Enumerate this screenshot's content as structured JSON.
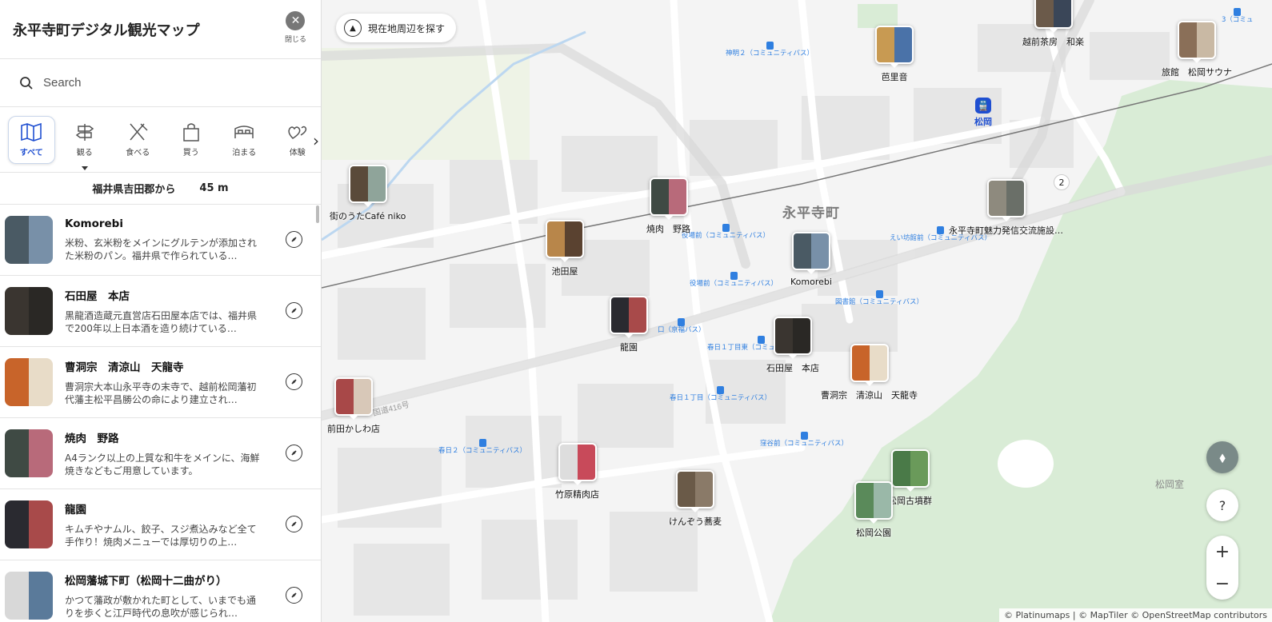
{
  "sidebar": {
    "title": "永平寺町デジタル観光マップ",
    "close_label": "閉じる",
    "search_placeholder": "Search",
    "categories": [
      {
        "label": "すべて",
        "icon": "map-icon"
      },
      {
        "label": "観る",
        "icon": "signpost-icon"
      },
      {
        "label": "食べる",
        "icon": "fork-knife-icon"
      },
      {
        "label": "買う",
        "icon": "shopping-bag-icon"
      },
      {
        "label": "泊まる",
        "icon": "bed-icon"
      },
      {
        "label": "体験",
        "icon": "hearts-icon"
      }
    ],
    "distance_from": "福井県吉田郡から",
    "distance_value": "45 m",
    "items": [
      {
        "name": "Komorebi",
        "desc": "米粉、玄米粉をメインにグルテンが添加された米粉のパン。福井県で作られている…"
      },
      {
        "name": "石田屋　本店",
        "desc": "黒龍酒造蔵元直営店石田屋本店では、福井県で200年以上日本酒を造り続けている…"
      },
      {
        "name": "曹洞宗　清涼山　天龍寺",
        "desc": "曹洞宗大本山永平寺の末寺で、越前松岡藩初代藩主松平昌勝公の命により建立され…"
      },
      {
        "name": "焼肉　野路",
        "desc": "A4ランク以上の上質な和牛をメインに、海鮮焼きなどもご用意しています。"
      },
      {
        "name": "龍園",
        "desc": "キムチやナムル、餃子、スジ煮込みなど全て手作り！焼肉メニューでは厚切りの上…"
      },
      {
        "name": "松岡藩城下町（松岡十二曲がり）",
        "desc": "かつて藩政が敷かれた町として、いまでも通りを歩くと江戸時代の息吹が感じられ…"
      }
    ]
  },
  "map": {
    "search_area_label": "現在地周辺を探す",
    "town_label": "永平寺町",
    "area_label": "松岡室",
    "road_label": "国道416号",
    "station_label": "松岡",
    "pins": [
      {
        "label": "越前茶房　和楽"
      },
      {
        "label": "芭里音"
      },
      {
        "label": "旅館　松岡サウナ"
      },
      {
        "label": "街のうたCafé niko"
      },
      {
        "label": "焼肉　野路"
      },
      {
        "label": "永平寺町魅力発信交流施設…",
        "count": "2"
      },
      {
        "label": "池田屋"
      },
      {
        "label": "Komorebi"
      },
      {
        "label": "龍園"
      },
      {
        "label": "石田屋　本店"
      },
      {
        "label": "曹洞宗　清涼山　天龍寺"
      },
      {
        "label": "前田かしわ店"
      },
      {
        "label": "竹原精肉店"
      },
      {
        "label": "けんぞう蕎麦"
      },
      {
        "label": "松岡古墳群"
      },
      {
        "label": "松岡公園"
      }
    ],
    "bus_stops": [
      "神明２（コミュニティバス）",
      "役場前（コミュニティバス）",
      "役場前（コミュニティバス）",
      "えい坊館前（コミュニティバス）",
      "図書館（コミュニティバス）",
      "春日１丁目東（コミュニティバス）",
      "口（京福バス）",
      "春日１丁目（コミュニティバス）",
      "春日２（コミュニティバス）",
      "窪谷前（コミュニティバス）",
      "3（コミュ"
    ],
    "help_label": "?",
    "zoom_in": "+",
    "zoom_out": "−",
    "attribution": "© Platinumaps | © MapTiler © OpenStreetMap contributors"
  },
  "colors": {
    "accent_blue": "#1f4fd1",
    "bus_blue": "#2f7fe0",
    "forest_green": "#d9ecd6"
  }
}
